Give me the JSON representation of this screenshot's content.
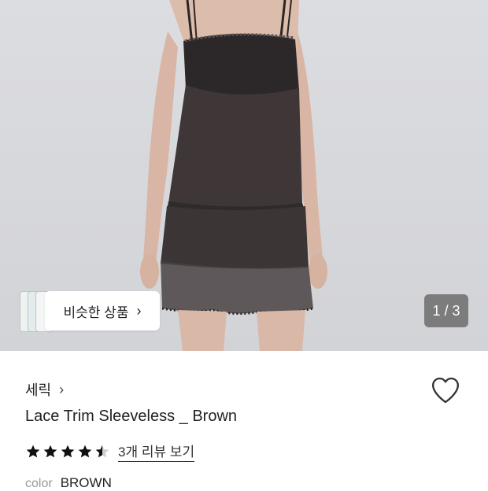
{
  "gallery": {
    "current_page": 1,
    "total_pages": 3,
    "indicator_text": "1 / 3",
    "similar_label": "비슷한 상품",
    "similar_chevron": "›"
  },
  "product": {
    "brand": "세릭",
    "brand_chevron": "›",
    "title": "Lace Trim Sleeveless _ Brown",
    "rating": 4.5,
    "review_link": "3개 리뷰 보기",
    "color_label": "color",
    "color_value": "BROWN"
  },
  "icons": {
    "favorite": "heart-outline-icon",
    "star": "star-icon"
  },
  "colors": {
    "star": "#111111",
    "heart_stroke": "#333333",
    "dress": "#3c3536",
    "lace": "#2a2627",
    "skin": "#d9b9a8"
  }
}
